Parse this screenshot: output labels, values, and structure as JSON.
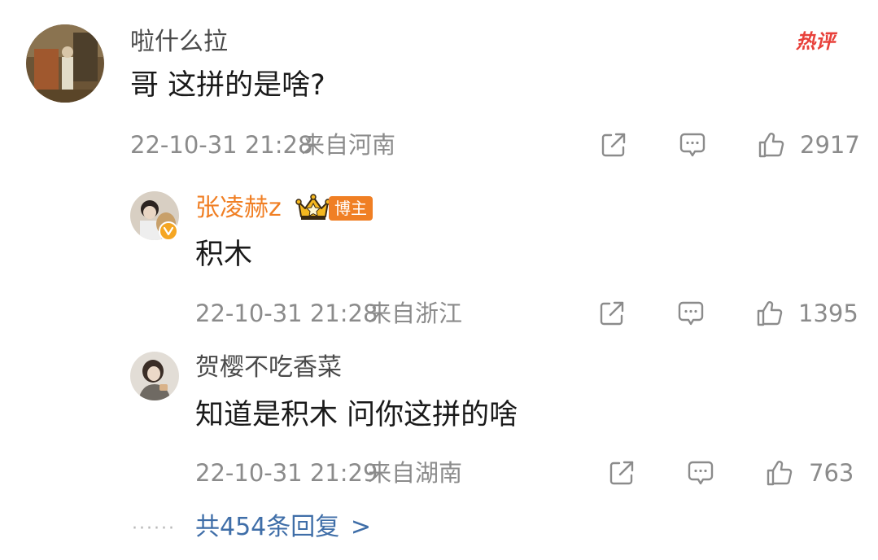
{
  "main_comment": {
    "username": "啦什么拉",
    "hot_label": "热评",
    "text": "哥 这拼的是啥?",
    "timestamp": "22-10-31 21:28",
    "location": "来自河南",
    "likes": "2917"
  },
  "replies": [
    {
      "username": "张凌赫z",
      "badge": "博主",
      "text": "积木",
      "timestamp": "22-10-31 21:28",
      "location": "来自浙江",
      "likes": "1395"
    },
    {
      "username": "贺樱不吃香菜",
      "text": "知道是积木 问你这拼的啥",
      "timestamp": "22-10-31 21:29",
      "location": "来自湖南",
      "likes": "763"
    }
  ],
  "more_replies": {
    "label": "共454条回复",
    "arrow": ">"
  },
  "icons": {
    "share": "share-icon",
    "comment": "comment-icon",
    "like": "thumbs-up-icon"
  },
  "colors": {
    "blogger_name": "#f07f24",
    "link": "#3f6ea8",
    "hot": "#e8403a",
    "meta": "#8b8b8b"
  }
}
